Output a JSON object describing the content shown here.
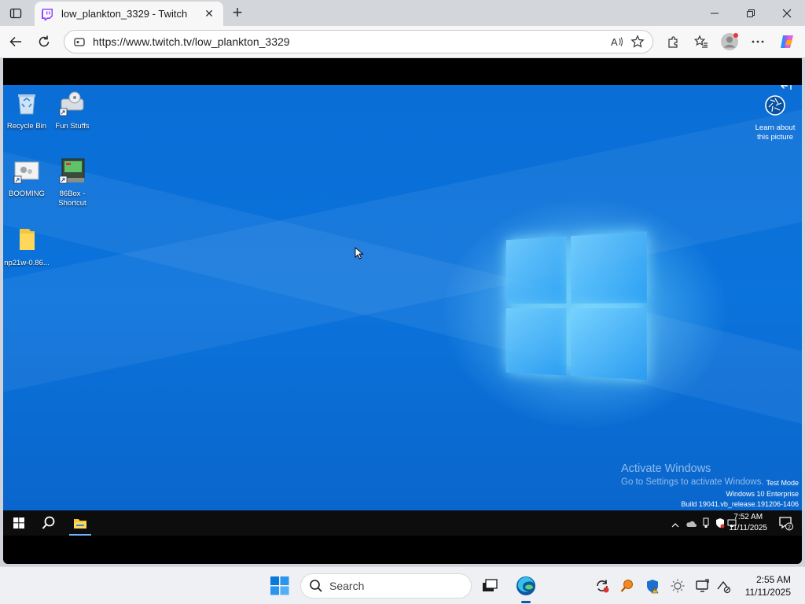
{
  "browser": {
    "tab_title": "low_plankton_3329 - Twitch",
    "url": "https://www.twitch.tv/low_plankton_3329"
  },
  "desktop": {
    "icons": [
      {
        "label": "Recycle Bin",
        "icon": "recycle-bin-icon"
      },
      {
        "label": "Fun Stuffs",
        "icon": "shortcut-icon"
      },
      {
        "label": "BOOMING",
        "icon": "shortcut-icon"
      },
      {
        "label": "86Box - Shortcut",
        "icon": "shortcut-icon"
      },
      {
        "label": "np21w-0.86...",
        "icon": "folder-icon"
      }
    ],
    "learn_label": "Learn about this picture",
    "activate_title": "Activate Windows",
    "activate_sub": "Go to Settings to activate Windows.",
    "test_mode": "Test Mode",
    "edition": "Windows 10 Enterprise",
    "build": "Build 19041.vb_release.191206-1406"
  },
  "vm_taskbar": {
    "time": "7:52 AM",
    "date": "11/11/2025",
    "notif_count": "2"
  },
  "host_taskbar": {
    "search_placeholder": "Search",
    "time": "2:55 AM",
    "date": "11/11/2025"
  },
  "colors": {
    "twitch": "#9146ff",
    "desktop_blue": "#0b6fd8",
    "edge_blue": "#0c59a4"
  }
}
